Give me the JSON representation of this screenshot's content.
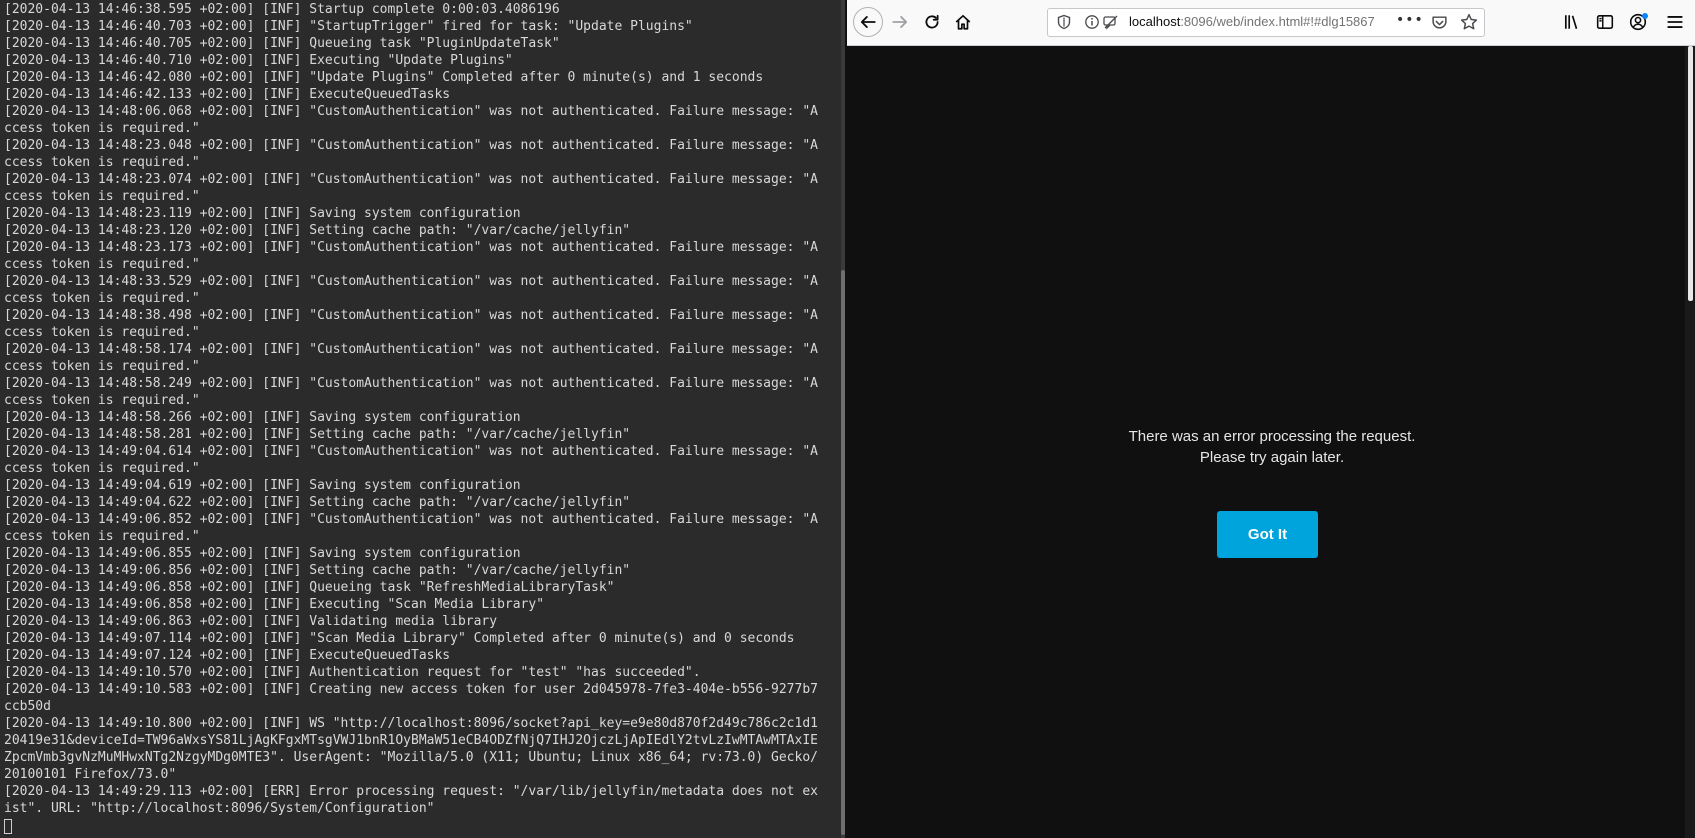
{
  "terminal": {
    "lines": [
      "[2020-04-13 14:46:38.595 +02:00] [INF] Startup complete 0:00:03.4086196",
      "[2020-04-13 14:46:40.703 +02:00] [INF] \"StartupTrigger\" fired for task: \"Update Plugins\"",
      "[2020-04-13 14:46:40.705 +02:00] [INF] Queueing task \"PluginUpdateTask\"",
      "[2020-04-13 14:46:40.710 +02:00] [INF] Executing \"Update Plugins\"",
      "[2020-04-13 14:46:42.080 +02:00] [INF] \"Update Plugins\" Completed after 0 minute(s) and 1 seconds",
      "[2020-04-13 14:46:42.133 +02:00] [INF] ExecuteQueuedTasks",
      "[2020-04-13 14:48:06.068 +02:00] [INF] \"CustomAuthentication\" was not authenticated. Failure message: \"A",
      "ccess token is required.\"",
      "[2020-04-13 14:48:23.048 +02:00] [INF] \"CustomAuthentication\" was not authenticated. Failure message: \"A",
      "ccess token is required.\"",
      "[2020-04-13 14:48:23.074 +02:00] [INF] \"CustomAuthentication\" was not authenticated. Failure message: \"A",
      "ccess token is required.\"",
      "[2020-04-13 14:48:23.119 +02:00] [INF] Saving system configuration",
      "[2020-04-13 14:48:23.120 +02:00] [INF] Setting cache path: \"/var/cache/jellyfin\"",
      "[2020-04-13 14:48:23.173 +02:00] [INF] \"CustomAuthentication\" was not authenticated. Failure message: \"A",
      "ccess token is required.\"",
      "[2020-04-13 14:48:33.529 +02:00] [INF] \"CustomAuthentication\" was not authenticated. Failure message: \"A",
      "ccess token is required.\"",
      "[2020-04-13 14:48:38.498 +02:00] [INF] \"CustomAuthentication\" was not authenticated. Failure message: \"A",
      "ccess token is required.\"",
      "[2020-04-13 14:48:58.174 +02:00] [INF] \"CustomAuthentication\" was not authenticated. Failure message: \"A",
      "ccess token is required.\"",
      "[2020-04-13 14:48:58.249 +02:00] [INF] \"CustomAuthentication\" was not authenticated. Failure message: \"A",
      "ccess token is required.\"",
      "[2020-04-13 14:48:58.266 +02:00] [INF] Saving system configuration",
      "[2020-04-13 14:48:58.281 +02:00] [INF] Setting cache path: \"/var/cache/jellyfin\"",
      "[2020-04-13 14:49:04.614 +02:00] [INF] \"CustomAuthentication\" was not authenticated. Failure message: \"A",
      "ccess token is required.\"",
      "[2020-04-13 14:49:04.619 +02:00] [INF] Saving system configuration",
      "[2020-04-13 14:49:04.622 +02:00] [INF] Setting cache path: \"/var/cache/jellyfin\"",
      "[2020-04-13 14:49:06.852 +02:00] [INF] \"CustomAuthentication\" was not authenticated. Failure message: \"A",
      "ccess token is required.\"",
      "[2020-04-13 14:49:06.855 +02:00] [INF] Saving system configuration",
      "[2020-04-13 14:49:06.856 +02:00] [INF] Setting cache path: \"/var/cache/jellyfin\"",
      "[2020-04-13 14:49:06.858 +02:00] [INF] Queueing task \"RefreshMediaLibraryTask\"",
      "[2020-04-13 14:49:06.858 +02:00] [INF] Executing \"Scan Media Library\"",
      "[2020-04-13 14:49:06.863 +02:00] [INF] Validating media library",
      "[2020-04-13 14:49:07.114 +02:00] [INF] \"Scan Media Library\" Completed after 0 minute(s) and 0 seconds",
      "[2020-04-13 14:49:07.124 +02:00] [INF] ExecuteQueuedTasks",
      "[2020-04-13 14:49:10.570 +02:00] [INF] Authentication request for \"test\" \"has succeeded\".",
      "[2020-04-13 14:49:10.583 +02:00] [INF] Creating new access token for user 2d045978-7fe3-404e-b556-9277b7",
      "ccb50d",
      "[2020-04-13 14:49:10.800 +02:00] [INF] WS \"http://localhost:8096/socket?api_key=e9e80d870f2d49c786c2c1d1",
      "20419e31&deviceId=TW96aWxsYS81LjAgKFgxMTsgVWJ1bnR1OyBMaW51eCB4ODZfNjQ7IHJ2OjczLjApIEdlY2tvLzIwMTAwMTAxIE",
      "ZpcmVmb3gvNzMuMHwxNTg2NzgyMDg0MTE3\". UserAgent: \"Mozilla/5.0 (X11; Ubuntu; Linux x86_64; rv:73.0) Gecko/",
      "20100101 Firefox/73.0\"",
      "[2020-04-13 14:49:29.113 +02:00] [ERR] Error processing request: \"/var/lib/jellyfin/metadata does not ex",
      "ist\". URL: \"http://localhost:8096/System/Configuration\""
    ]
  },
  "browser": {
    "url_host": "localhost",
    "url_path": ":8096/web/index.html#!#dlg15867",
    "url_more": "•••",
    "icons": {
      "back": "back-arrow-icon",
      "forward": "forward-arrow-icon",
      "reload": "reload-icon",
      "home": "home-icon",
      "library": "library-icon",
      "sidebar": "sidebar-icon",
      "account": "account-icon",
      "menu": "hamburger-menu-icon"
    },
    "accent_color": "#00a4dc"
  },
  "dialog": {
    "message_line1": "There was an error processing the request.",
    "message_line2": "Please try again later.",
    "button_label": "Got It"
  }
}
